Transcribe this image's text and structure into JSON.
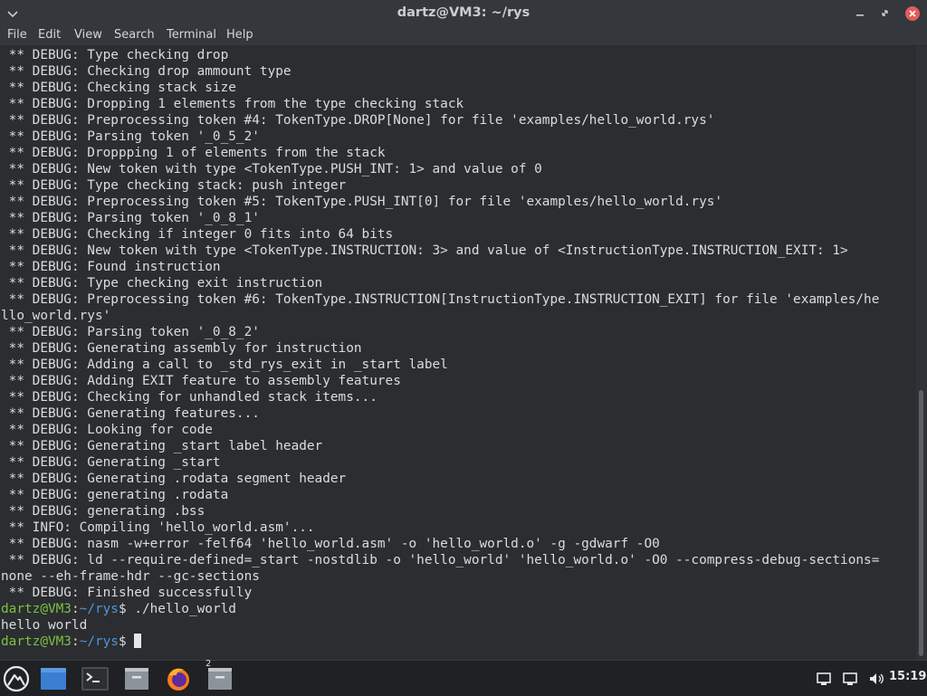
{
  "window": {
    "title": "dartz@VM3: ~/rys"
  },
  "menu": {
    "file": "File",
    "edit": "Edit",
    "view": "View",
    "search": "Search",
    "terminal": "Terminal",
    "help": "Help"
  },
  "terminal": {
    "lines": [
      " ** DEBUG: Type checking drop",
      " ** DEBUG: Checking drop ammount type",
      " ** DEBUG: Checking stack size",
      " ** DEBUG: Dropping 1 elements from the type checking stack",
      " ** DEBUG: Preprocessing token #4: TokenType.DROP[None] for file 'examples/hello_world.rys'",
      " ** DEBUG: Parsing token '_0_5_2'",
      " ** DEBUG: Droppping 1 of elements from the stack",
      " ** DEBUG: New token with type <TokenType.PUSH_INT: 1> and value of 0",
      " ** DEBUG: Type checking stack: push integer",
      " ** DEBUG: Preprocessing token #5: TokenType.PUSH_INT[0] for file 'examples/hello_world.rys'",
      " ** DEBUG: Parsing token '_0_8_1'",
      " ** DEBUG: Checking if integer 0 fits into 64 bits",
      " ** DEBUG: New token with type <TokenType.INSTRUCTION: 3> and value of <InstructionType.INSTRUCTION_EXIT: 1>",
      " ** DEBUG: Found instruction",
      " ** DEBUG: Type checking exit instruction",
      " ** DEBUG: Preprocessing token #6: TokenType.INSTRUCTION[InstructionType.INSTRUCTION_EXIT] for file 'examples/he",
      "llo_world.rys'",
      " ** DEBUG: Parsing token '_0_8_2'",
      " ** DEBUG: Generating assembly for instruction",
      " ** DEBUG: Adding a call to _std_rys_exit in _start label",
      " ** DEBUG: Adding EXIT feature to assembly features",
      " ** DEBUG: Checking for unhandled stack items...",
      " ** DEBUG: Generating features...",
      " ** DEBUG: Looking for code",
      " ** DEBUG: Generating _start label header",
      " ** DEBUG: Generating _start",
      " ** DEBUG: Generating .rodata segment header",
      " ** DEBUG: generating .rodata",
      " ** DEBUG: generating .bss",
      " ** INFO: Compiling 'hello_world.asm'...",
      " ** DEBUG: nasm -w+error -felf64 'hello_world.asm' -o 'hello_world.o' -g -gdwarf -O0",
      " ** DEBUG: ld --require-defined=_start -nostdlib -o 'hello_world' 'hello_world.o' -O0 --compress-debug-sections=",
      "none --eh-frame-hdr --gc-sections",
      " ** DEBUG: Finished successfully"
    ],
    "prompt_user": "dartz@VM3",
    "prompt_sep": ":",
    "prompt_path": "~/rys",
    "prompt_dollar": "$ ",
    "command": "./hello_world",
    "output": "hello world"
  },
  "taskbar": {
    "items": [
      "start-menu-icon",
      "show-desktop-icon",
      "terminal-icon",
      "file-manager-icon",
      "firefox-icon",
      "file-manager-icon"
    ],
    "badge": "2",
    "clock": "15:19"
  }
}
